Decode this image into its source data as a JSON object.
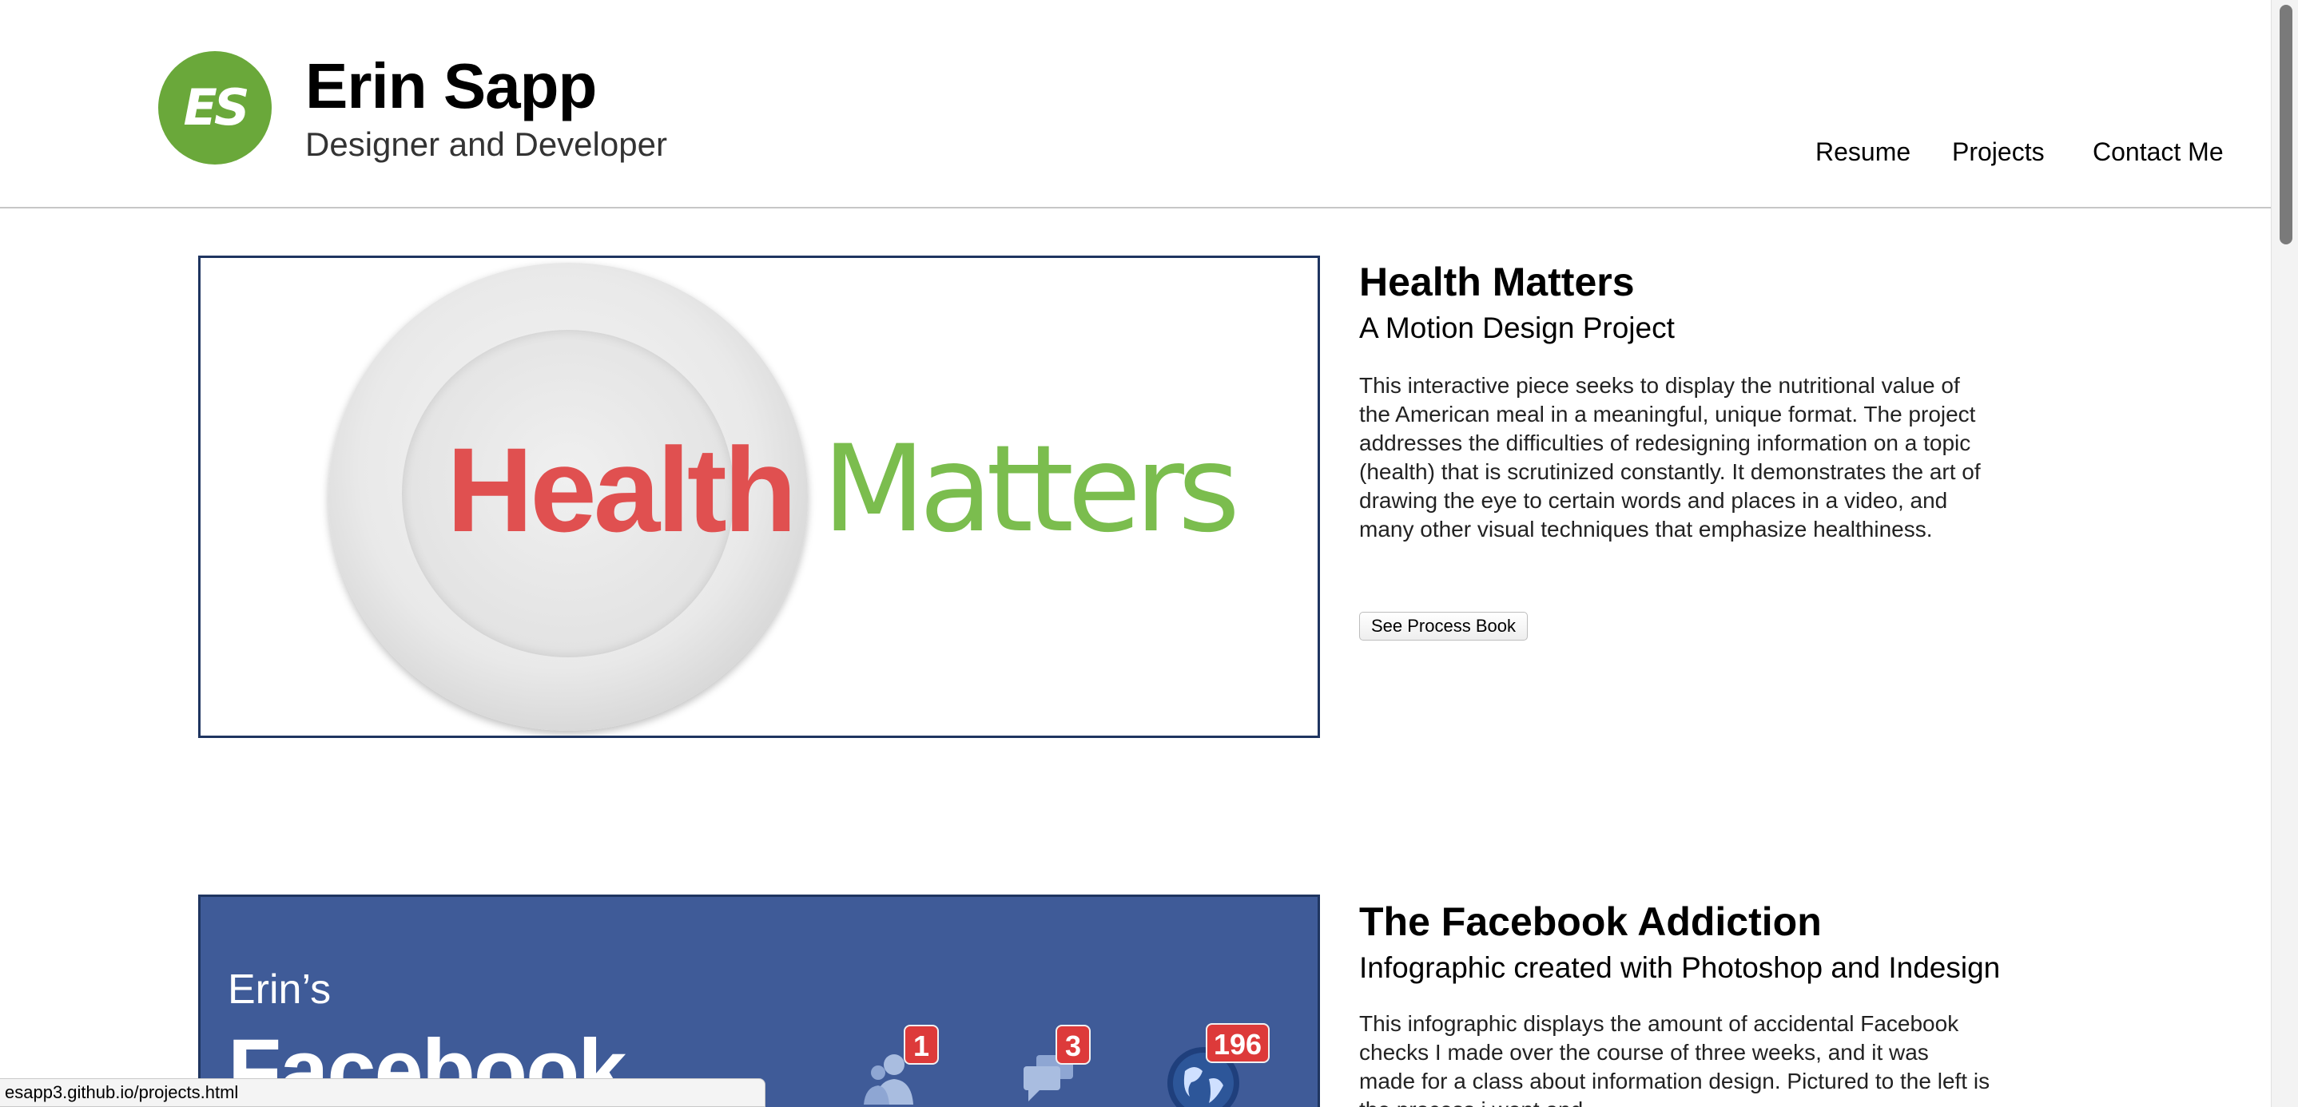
{
  "site": {
    "logo_initials": "ES",
    "name": "Erin Sapp",
    "tagline": "Designer and Developer"
  },
  "nav": {
    "resume": "Resume",
    "projects": "Projects",
    "contact": "Contact Me"
  },
  "projects": [
    {
      "image_text": {
        "word1": "Health",
        "word2": "Matters"
      },
      "title": "Health Matters",
      "subtitle": "A Motion Design Project",
      "description": "This interactive piece seeks to display the nutritional value of the American meal in a meaningful, unique format. The project addresses the difficulties of redesigning information on a topic (health) that is scrutinized constantly. It demonstrates the art of drawing the eye to certain words and places in a video, and many other visual techniques that emphasize healthiness.",
      "button_label": "See Process Book"
    },
    {
      "image_text": {
        "line1": "Erin’s",
        "line2": "Facebook"
      },
      "badges": [
        "1",
        "3",
        "196"
      ],
      "title": "The Facebook Addiction",
      "subtitle": "Infographic created with Photoshop and Indesign",
      "description": "This infographic displays the amount of accidental Facebook checks I made over the course of three weeks, and it was made for a class about information design. Pictured to the left is the process i went and"
    }
  ],
  "status_bar": {
    "url": "esapp3.github.io/projects.html"
  },
  "colors": {
    "logo_green": "#6aa83a",
    "health_red": "#e05050",
    "matters_green": "#7bbd4e",
    "facebook_blue": "#3f5b98",
    "badge_red": "#dd3a3a"
  }
}
